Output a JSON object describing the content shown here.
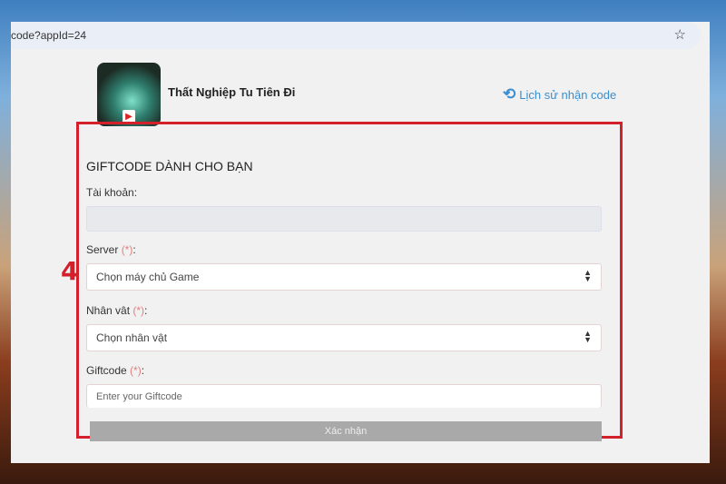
{
  "browser": {
    "url": "code?appId=24",
    "bookmark_icon": "star-icon"
  },
  "header": {
    "game_name": "Thất Nghiệp Tu Tiên Đi",
    "history_link": "Lịch sử nhận code",
    "history_icon": "history-icon"
  },
  "form": {
    "title": "GIFTCODE DÀNH CHO BẠN",
    "account_label": "Tài khoản:",
    "account_value": "",
    "server_label": "Server ",
    "required_mark": "(*)",
    "colon": ":",
    "server_placeholder": "Chọn máy chủ Game",
    "character_label": "Nhân vât ",
    "character_placeholder": "Chọn nhân vật",
    "giftcode_label": "Giftcode ",
    "giftcode_placeholder": "Enter your Giftcode",
    "submit": "Xác nhận"
  },
  "annotation": {
    "step": "4",
    "color": "#d3202a"
  }
}
